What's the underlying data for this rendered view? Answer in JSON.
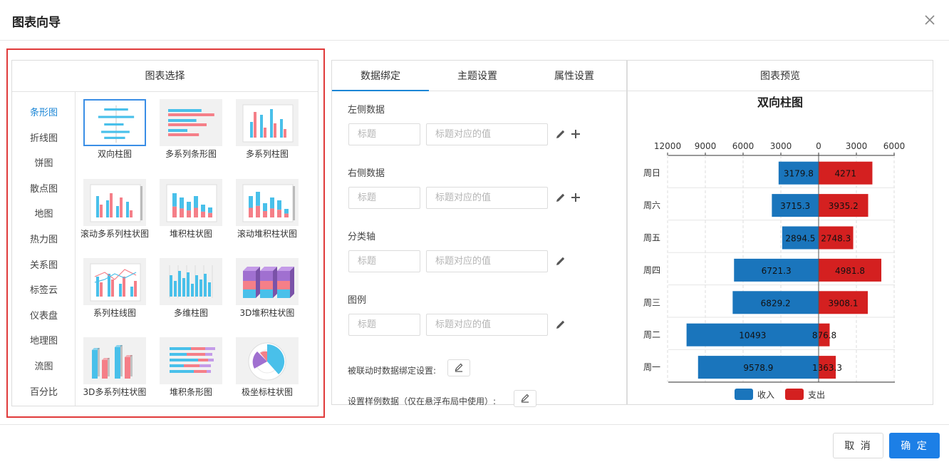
{
  "dialog": {
    "title": "图表向导"
  },
  "chart_select": {
    "title": "图表选择",
    "categories": [
      "条形图",
      "折线图",
      "饼图",
      "散点图",
      "地图",
      "热力图",
      "关系图",
      "标签云",
      "仪表盘",
      "地理图",
      "流图",
      "百分比"
    ],
    "active_category": "条形图",
    "thumbnails": [
      {
        "label": "双向柱图",
        "icon": "bidirectional-bar-icon"
      },
      {
        "label": "多系列条形图",
        "icon": "multi-series-bar-icon"
      },
      {
        "label": "多系列柱图",
        "icon": "multi-series-column-icon"
      },
      {
        "label": "滚动多系列柱状图",
        "icon": "scroll-multi-column-icon"
      },
      {
        "label": "堆积柱状图",
        "icon": "stacked-column-icon"
      },
      {
        "label": "滚动堆积柱状图",
        "icon": "scroll-stacked-column-icon"
      },
      {
        "label": "系列柱线图",
        "icon": "column-line-icon"
      },
      {
        "label": "多维柱图",
        "icon": "multi-dim-column-icon"
      },
      {
        "label": "3D堆积柱状图",
        "icon": "3d-stacked-column-icon"
      },
      {
        "label": "3D多系列柱状图",
        "icon": "3d-multi-column-icon"
      },
      {
        "label": "堆积条形图",
        "icon": "stacked-bar-icon"
      },
      {
        "label": "极坐标柱状图",
        "icon": "polar-bar-icon"
      }
    ]
  },
  "binding": {
    "tabs": [
      "数据绑定",
      "主题设置",
      "属性设置"
    ],
    "active_tab": "数据绑定",
    "sections": [
      {
        "label": "左侧数据",
        "title_placeholder": "标题",
        "value_placeholder": "标题对应的值",
        "has_add": true
      },
      {
        "label": "右侧数据",
        "title_placeholder": "标题",
        "value_placeholder": "标题对应的值",
        "has_add": true
      },
      {
        "label": "分类轴",
        "title_placeholder": "标题",
        "value_placeholder": "标题对应的值",
        "has_add": false
      },
      {
        "label": "图例",
        "title_placeholder": "标题",
        "value_placeholder": "标题对应的值",
        "has_add": false
      }
    ],
    "linkage_label": "被联动时数据绑定设置:",
    "sample_label": "设置样例数据（仅在悬浮布局中使用）:"
  },
  "preview": {
    "title": "图表预览"
  },
  "chart_data": {
    "type": "bar",
    "title": "双向柱图",
    "categories": [
      "周日",
      "周六",
      "周五",
      "周四",
      "周三",
      "周二",
      "周一"
    ],
    "left_axis_ticks": [
      "12000",
      "9000",
      "6000",
      "3000"
    ],
    "zero_tick": "0",
    "right_axis_ticks": [
      "3000",
      "6000"
    ],
    "left_max": 12000,
    "right_max": 6000,
    "series": [
      {
        "name": "收入",
        "color": "#1a75bc",
        "values": [
          3179.8,
          3715.3,
          2894.5,
          6721.3,
          6829.2,
          10493,
          9578.9
        ],
        "labels": [
          "3179.8",
          "3715.3",
          "2894.5",
          "6721.3",
          "6829.2",
          "10493",
          "9578.9"
        ]
      },
      {
        "name": "支出",
        "color": "#d42020",
        "values": [
          4271,
          3935.2,
          2748.3,
          4981.8,
          3908.1,
          876.8,
          1363.3
        ],
        "labels": [
          "4271",
          "3935.2",
          "2748.3",
          "4981.8",
          "3908.1",
          "876.8",
          "1363.3"
        ]
      }
    ],
    "legend_position": "bottom",
    "grid": true
  },
  "footer": {
    "cancel_label": "取 消",
    "ok_label": "确 定"
  },
  "colors": {
    "accent": "#1c7fe6",
    "highlight_frame": "#e03a3a"
  }
}
